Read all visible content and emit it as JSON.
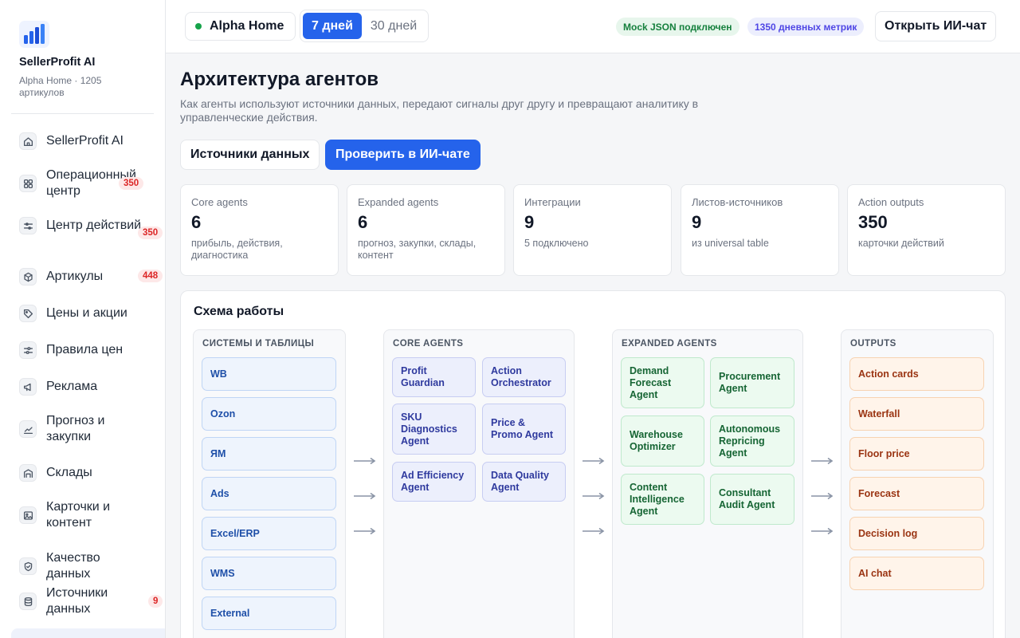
{
  "sidebar": {
    "brand": "SellerProfit AI",
    "subtitle": "Alpha Home · 1205 артикулов",
    "items": [
      {
        "label": "SellerProfit AI",
        "icon": "home-icon",
        "badge": ""
      },
      {
        "label": "Операционный центр",
        "icon": "grid-icon",
        "badge": "350"
      },
      {
        "label": "Центр действий",
        "icon": "sliders-icon",
        "badge": "350"
      },
      {
        "label": "Артикулы",
        "icon": "box-icon",
        "badge": "448"
      },
      {
        "label": "Цены и акции",
        "icon": "tag-icon",
        "badge": ""
      },
      {
        "label": "Правила цен",
        "icon": "switches-icon",
        "badge": ""
      },
      {
        "label": "Реклама",
        "icon": "megaphone-icon",
        "badge": ""
      },
      {
        "label": "Прогноз и закупки",
        "icon": "chart-icon",
        "badge": ""
      },
      {
        "label": "Склады",
        "icon": "warehouse-icon",
        "badge": ""
      },
      {
        "label": "Карточки и контент",
        "icon": "image-icon",
        "badge": ""
      },
      {
        "label": "Качество данных",
        "icon": "shield-icon",
        "badge": ""
      },
      {
        "label": "Источники данных",
        "icon": "database-icon",
        "badge": "9"
      }
    ]
  },
  "topbar": {
    "store": "Alpha Home",
    "ranges": [
      "7 дней",
      "30 дней"
    ],
    "active_range": "7 дней",
    "mock_chip": "Mock JSON подключен",
    "metrics_chip": "1350 дневных метрик",
    "open_chat": "Открыть ИИ-чат"
  },
  "page": {
    "title": "Архитектура агентов",
    "description": "Как агенты используют источники данных, передают сигналы друг другу и превращают аналитику в управленческие действия.",
    "btn_sources": "Источники данных",
    "btn_check": "Проверить в ИИ-чате"
  },
  "stats": [
    {
      "label": "Core agents",
      "value": "6",
      "sub": "прибыль, действия, диагностика"
    },
    {
      "label": "Expanded agents",
      "value": "6",
      "sub": "прогноз, закупки, склады, контент"
    },
    {
      "label": "Интеграции",
      "value": "9",
      "sub": "5 подключено"
    },
    {
      "label": "Листов-источников",
      "value": "9",
      "sub": "из universal table"
    },
    {
      "label": "Action outputs",
      "value": "350",
      "sub": "карточки действий"
    }
  ],
  "schema": {
    "title": "Схема работы",
    "columns": {
      "sources": {
        "title": "СИСТЕМЫ И ТАБЛИЦЫ",
        "items": [
          "WB",
          "Ozon",
          "ЯМ",
          "Ads",
          "Excel/ERP",
          "WMS",
          "External"
        ]
      },
      "core": {
        "title": "CORE AGENTS",
        "items": [
          "Profit Guardian",
          "Action Orchestrator",
          "SKU Diagnostics Agent",
          "Price & Promo Agent",
          "Ad Efficiency Agent",
          "Data Quality Agent"
        ]
      },
      "expanded": {
        "title": "EXPANDED AGENTS",
        "items": [
          "Demand Forecast Agent",
          "Procurement Agent",
          "Warehouse Optimizer",
          "Autonomous Repricing Agent",
          "Content Intelligence Agent",
          "Consultant Audit Agent"
        ]
      },
      "outputs": {
        "title": "OUTPUTS",
        "items": [
          "Action cards",
          "Waterfall",
          "Floor price",
          "Forecast",
          "Decision log",
          "AI chat"
        ]
      }
    }
  },
  "colors": {
    "accent": "#2563eb",
    "badge_red": "#dc2626",
    "status_green": "#16a34a"
  }
}
